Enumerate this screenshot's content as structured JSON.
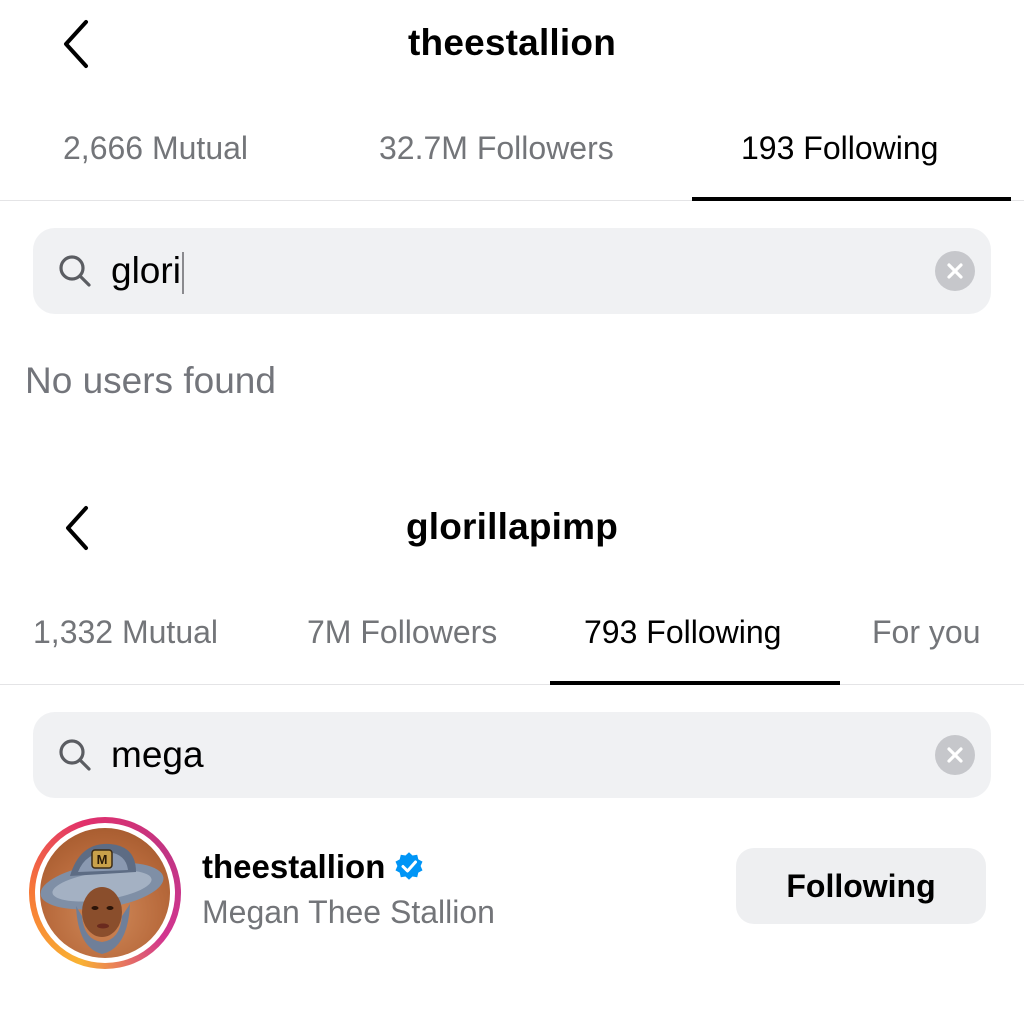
{
  "panel1": {
    "title": "theestallion",
    "tabs": [
      {
        "label": "2,666 Mutual"
      },
      {
        "label": "32.7M Followers"
      },
      {
        "label": "193 Following"
      }
    ],
    "active_tab": "193 Following",
    "search": {
      "value": "glori",
      "icon": "search-icon",
      "clear_icon": "clear-icon"
    },
    "empty_message": "No users found"
  },
  "panel2": {
    "title": "glorillapimp",
    "tabs": [
      {
        "label": "1,332 Mutual"
      },
      {
        "label": "7M Followers"
      },
      {
        "label": "793 Following"
      },
      {
        "label": "For you"
      }
    ],
    "active_tab": "793 Following",
    "search": {
      "value": "mega",
      "icon": "search-icon",
      "clear_icon": "clear-icon"
    },
    "result": {
      "username": "theestallion",
      "verified": true,
      "full_name": "Megan Thee Stallion",
      "button_label": "Following"
    }
  },
  "colors": {
    "text_primary": "#000000",
    "text_secondary": "#737579",
    "search_bg": "#f0f1f3",
    "verified_blue": "#0095f6",
    "button_bg": "#eeeff1"
  }
}
